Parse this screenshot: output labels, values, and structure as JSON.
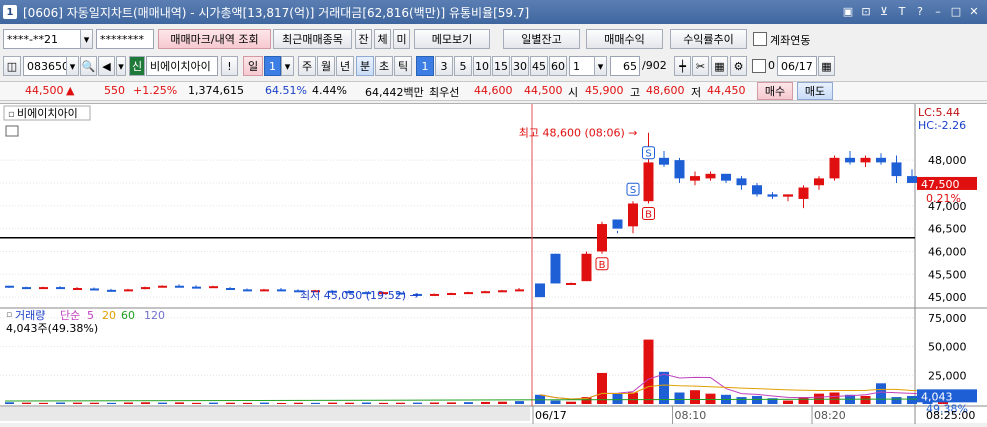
{
  "window": {
    "number": "1",
    "title": "[0606] 자동일지차트(매매내역) - 시가총액[13,817(억)] 거래대금[62,816(백만)] 유통비율[59.7]",
    "controls": [
      "▣",
      "⊡",
      "⊻",
      "T",
      "?",
      "–",
      "□",
      "✕"
    ]
  },
  "toolbar1": {
    "account": "****-**21",
    "password": "********",
    "btn_trade_mark": "매매마크/내역 조회",
    "btn_recent": "최근매매종목",
    "btn_jan": "잔",
    "btn_che": "체",
    "btn_mi": "미",
    "btn_memo": "메모보기",
    "btn_daily": "일별잔고",
    "btn_profit": "매매수익",
    "btn_rate": "수익률추이",
    "chk_account_link": "계좌연동"
  },
  "toolbar2": {
    "code": "083650",
    "shin": "신",
    "name": "비에이치아이",
    "excl": "!",
    "period_il": "일",
    "period_value": "1",
    "periods": [
      "주",
      "월",
      "년",
      "분",
      "초",
      "틱"
    ],
    "intervals": [
      "1",
      "3",
      "5",
      "10",
      "15",
      "30",
      "45",
      "60"
    ],
    "count": "1",
    "range": "65",
    "range_total": "/902",
    "date_chk_label": "0",
    "date": "06/17"
  },
  "quote": {
    "price": "44,500",
    "arrow": "▲",
    "change": "550",
    "change_pct": "+1.25%",
    "volume": "1,374,615",
    "ratio1": "64.51%",
    "ratio2": "4.44%",
    "amount": "64,442백만",
    "best_label": "최우선",
    "best_sell": "44,600",
    "best_buy": "44,500",
    "open_label": "시",
    "open": "45,900",
    "high_label": "고",
    "high": "48,600",
    "low_label": "저",
    "low": "44,450",
    "buy_btn": "매수",
    "sell_btn": "매도"
  },
  "chart_labels": {
    "stock_name": "비에이치아이",
    "high_annot": "최고 48,600 (08:06) →",
    "low_annot": "최저 45,050 (19:52) →",
    "lc": "LC:5.44",
    "hc": "HC:-2.26",
    "current_price": "47,500",
    "current_pct": "0.21%",
    "vol_title": "거래량",
    "ma_title": "단순",
    "ma_periods": [
      "5",
      "20",
      "60",
      "120"
    ],
    "vol_summary": "4,043주(49.38%)",
    "vol_current": "4,043",
    "vol_pct": "49.38%",
    "marker_buy": "B",
    "marker_sell": "S",
    "time_end": "08:25:00"
  },
  "colors": {
    "up": "#e01010",
    "down": "#1f5fd6",
    "ma5": "#c040c0",
    "ma20": "#e0a000",
    "ma60": "#20a020",
    "ma120": "#7070d0"
  },
  "chart_data": {
    "type": "candlestick",
    "y_ticks": [
      45000,
      45500,
      46000,
      46500,
      47000,
      47500,
      48000
    ],
    "vol_ticks": [
      25000,
      50000,
      75000
    ],
    "x_labels": [
      "06/17",
      "08:10",
      "08:20"
    ],
    "reference_line": 46300,
    "pre_candles": [
      [
        45250,
        45250,
        45200,
        45220
      ],
      [
        45220,
        45230,
        45200,
        45210
      ],
      [
        45200,
        45230,
        45190,
        45220
      ],
      [
        45220,
        45240,
        45200,
        45210
      ],
      [
        45200,
        45220,
        45180,
        45200
      ],
      [
        45190,
        45210,
        45170,
        45180
      ],
      [
        45160,
        45180,
        45140,
        45150
      ],
      [
        45150,
        45180,
        45140,
        45170
      ],
      [
        45180,
        45230,
        45170,
        45220
      ],
      [
        45220,
        45260,
        45210,
        45250
      ],
      [
        45250,
        45280,
        45220,
        45230
      ],
      [
        45230,
        45260,
        45200,
        45210
      ],
      [
        45220,
        45250,
        45200,
        45240
      ],
      [
        45200,
        45220,
        45170,
        45180
      ],
      [
        45170,
        45190,
        45150,
        45160
      ],
      [
        45160,
        45180,
        45140,
        45170
      ],
      [
        45170,
        45200,
        45150,
        45160
      ],
      [
        45150,
        45170,
        45130,
        45140
      ],
      [
        45140,
        45160,
        45120,
        45150
      ],
      [
        45140,
        45160,
        45120,
        45130
      ],
      [
        45130,
        45150,
        45110,
        45120
      ],
      [
        45110,
        45130,
        45090,
        45100
      ],
      [
        45100,
        45120,
        45080,
        45110
      ],
      [
        45100,
        45110,
        45070,
        45080
      ],
      [
        45070,
        45090,
        45050,
        45060
      ],
      [
        45060,
        45080,
        45050,
        45070
      ],
      [
        45070,
        45100,
        45060,
        45090
      ],
      [
        45090,
        45120,
        45080,
        45110
      ],
      [
        45110,
        45140,
        45100,
        45130
      ],
      [
        45130,
        45160,
        45110,
        45150
      ],
      [
        45160,
        45200,
        45140,
        45170
      ]
    ],
    "candles": [
      [
        45300,
        45300,
        45050,
        45000
      ],
      [
        45950,
        45950,
        45300,
        45300
      ],
      [
        45300,
        45320,
        45280,
        45310
      ],
      [
        45350,
        46000,
        45350,
        45950
      ],
      [
        46000,
        46650,
        45950,
        46600
      ],
      [
        46700,
        46450,
        46400,
        46500
      ],
      [
        46550,
        47100,
        46400,
        47050
      ],
      [
        47100,
        48600,
        47050,
        47950
      ],
      [
        48050,
        48200,
        47850,
        47900
      ],
      [
        48000,
        48050,
        47500,
        47600
      ],
      [
        47550,
        47750,
        47450,
        47650
      ],
      [
        47600,
        47750,
        47550,
        47700
      ],
      [
        47700,
        47700,
        47500,
        47550
      ],
      [
        47600,
        47650,
        47350,
        47450
      ],
      [
        47450,
        47500,
        47200,
        47250
      ],
      [
        47250,
        47300,
        47150,
        47200
      ],
      [
        47200,
        47250,
        47100,
        47250
      ],
      [
        47150,
        47450,
        46950,
        47400
      ],
      [
        47450,
        47650,
        47350,
        47600
      ],
      [
        47600,
        48100,
        47550,
        48050
      ],
      [
        48050,
        48200,
        47900,
        47950
      ],
      [
        47950,
        48100,
        47850,
        48050
      ],
      [
        48050,
        48150,
        47900,
        47950
      ],
      [
        47950,
        48100,
        47500,
        47650
      ],
      [
        47650,
        47800,
        47500,
        47500
      ],
      [
        47500,
        47550,
        47450,
        47450
      ],
      [
        47450,
        47600,
        47400,
        47500
      ]
    ],
    "volumes": [
      8000,
      3000,
      2000,
      6000,
      27000,
      9000,
      10000,
      56000,
      28000,
      10000,
      12000,
      9000,
      8000,
      6000,
      7000,
      5000,
      3000,
      6000,
      9000,
      10000,
      8000,
      7000,
      18000,
      6000,
      7000,
      5000,
      4043
    ],
    "pre_volumes": [
      1500,
      1200,
      1000,
      1300,
      1200,
      1100,
      1000,
      1300,
      1500,
      1200,
      1400,
      1000,
      1200,
      1100,
      1000,
      1200,
      900,
      1100,
      1000,
      1200,
      1100,
      1300,
      1000,
      1100,
      1200,
      1300,
      1400,
      1600,
      1800,
      2000,
      2500
    ],
    "buy_markers": [
      4,
      7
    ],
    "sell_markers": [
      6,
      7
    ]
  }
}
